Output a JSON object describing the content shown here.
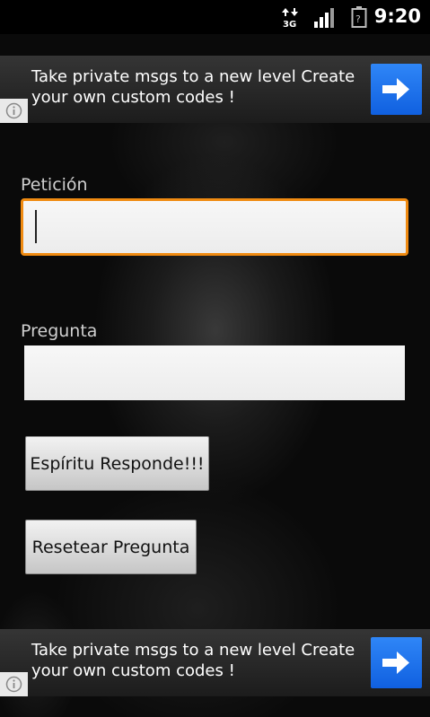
{
  "statusbar": {
    "network": "3G",
    "time": "9:20",
    "icons": [
      "data-3g-icon",
      "signal-bars-icon",
      "battery-unknown-icon"
    ]
  },
  "ad_top": {
    "text": "Take private msgs to a new level Create your own custom codes !",
    "icons": [
      "arrow-right-icon",
      "info-icon"
    ],
    "accent": "#1a6ef0"
  },
  "form": {
    "peticion_label": "Petición",
    "peticion_value": "",
    "pregunta_label": "Pregunta",
    "pregunta_value": "",
    "focus_color": "#f08b12"
  },
  "buttons": {
    "respond_label": "Espíritu Responde!!!",
    "reset_label": "Resetear Pregunta"
  },
  "ad_bottom": {
    "text": "Take private msgs to a new level Create your own custom codes !",
    "icons": [
      "arrow-right-icon",
      "info-icon"
    ]
  }
}
